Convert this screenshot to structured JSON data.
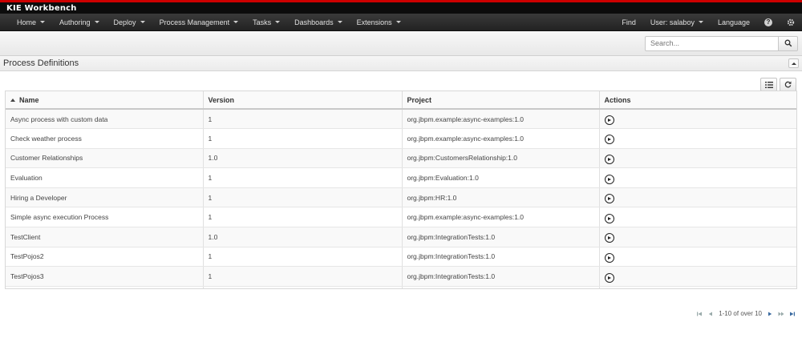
{
  "app": {
    "title": "KIE Workbench"
  },
  "nav": {
    "left": [
      {
        "label": "Home"
      },
      {
        "label": "Authoring"
      },
      {
        "label": "Deploy"
      },
      {
        "label": "Process Management"
      },
      {
        "label": "Tasks"
      },
      {
        "label": "Dashboards"
      },
      {
        "label": "Extensions"
      }
    ],
    "find": "Find",
    "user": "User: salaboy",
    "language": "Language",
    "help_icon": "question-icon",
    "settings_icon": "gear-icon"
  },
  "search": {
    "placeholder": "Search...",
    "icon": "search-icon"
  },
  "panel": {
    "title": "Process Definitions",
    "collapse_icon": "chevron-up-icon"
  },
  "toolbar": {
    "columns_icon": "list-icon",
    "refresh_icon": "refresh-icon"
  },
  "table": {
    "headers": {
      "name": "Name",
      "version": "Version",
      "project": "Project",
      "actions": "Actions"
    },
    "sort": {
      "column": "Name",
      "direction": "ascending"
    },
    "action_icon": "play-circle-icon",
    "rows": [
      {
        "name": "Async process with custom data",
        "version": "1",
        "project": "org.jbpm.example:async-examples:1.0"
      },
      {
        "name": "Check weather process",
        "version": "1",
        "project": "org.jbpm.example:async-examples:1.0"
      },
      {
        "name": "Customer Relationships",
        "version": "1.0",
        "project": "org.jbpm:CustomersRelationship:1.0"
      },
      {
        "name": "Evaluation",
        "version": "1",
        "project": "org.jbpm:Evaluation:1.0"
      },
      {
        "name": "Hiring a Developer",
        "version": "1",
        "project": "org.jbpm:HR:1.0"
      },
      {
        "name": "Simple async execution Process",
        "version": "1",
        "project": "org.jbpm.example:async-examples:1.0"
      },
      {
        "name": "TestClient",
        "version": "1.0",
        "project": "org.jbpm:IntegrationTests:1.0"
      },
      {
        "name": "TestPojos2",
        "version": "1",
        "project": "org.jbpm:IntegrationTests:1.0"
      },
      {
        "name": "TestPojos3",
        "version": "1",
        "project": "org.jbpm:IntegrationTests:1.0"
      },
      {
        "name": "",
        "version": "",
        "project": ""
      }
    ]
  },
  "pager": {
    "text": "1-10 of over 10"
  }
}
